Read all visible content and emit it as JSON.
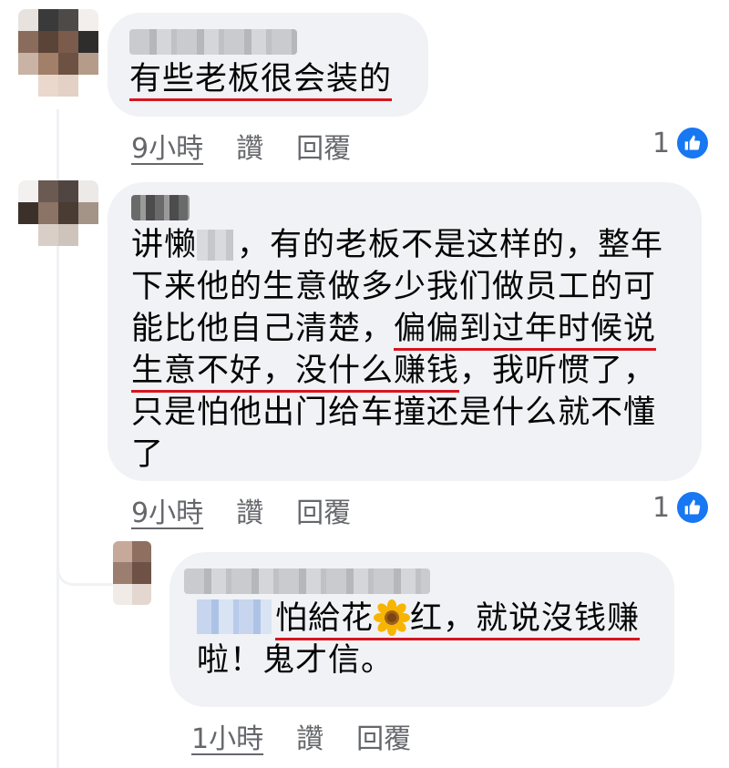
{
  "comments": [
    {
      "text": "有些老板很会装的",
      "time": "9小時",
      "like_label": "讚",
      "reply_label": "回覆",
      "like_count": "1"
    },
    {
      "line1_a": "讲懒",
      "line1_b": "，有的老板不是这样的，整年",
      "line2": "下来他的生意做多少我们做员工的可",
      "line3_a": "能比他自己清楚，",
      "line3_ul": "偏偏到过年时候说",
      "line4_ul": "生意不好，没什么赚钱",
      "line4_b": "，我听惯了，",
      "line5": "只是怕他出门给车撞还是什么就不懂",
      "line6": "了",
      "time": "9小時",
      "like_label": "讚",
      "reply_label": "回覆",
      "like_count": "1"
    }
  ],
  "reply": {
    "line1_a": "怕給花",
    "line1_b": "红，就说沒钱赚",
    "line2": "啦！鬼才信。",
    "time": "1小時",
    "like_label": "讚",
    "reply_label": "回覆"
  },
  "icons": {
    "like": "thumbs-up-icon",
    "emoji": "sunflower-emoji-icon"
  },
  "colors": {
    "bubble": "#f0f2f5",
    "underline_mark": "#d8141f",
    "like_blue": "#1877f2",
    "meta_text": "#65676b"
  }
}
